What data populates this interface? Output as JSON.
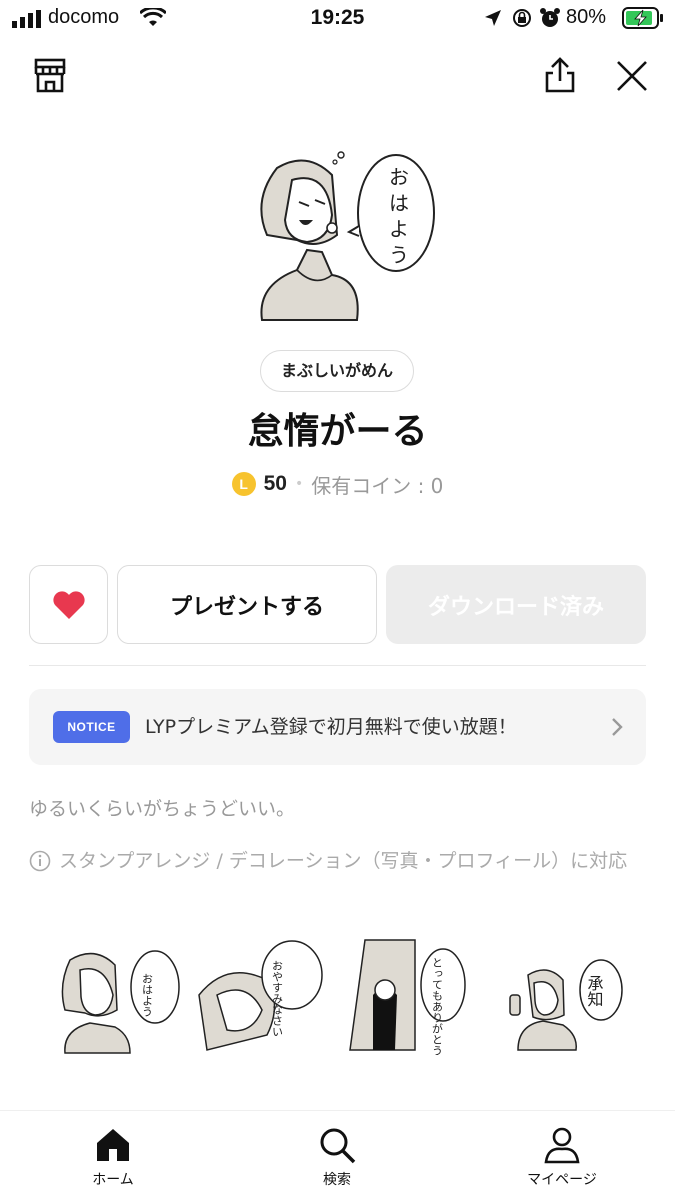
{
  "status_bar": {
    "carrier": "docomo",
    "time": "19:25",
    "battery_percent": "80%"
  },
  "header": {
    "icons": [
      "shop-icon",
      "share-icon",
      "close-icon"
    ]
  },
  "sticker": {
    "creator": "まぶしいがめん",
    "title": "怠惰がーる",
    "coin_symbol": "L",
    "price": "50",
    "owned_coins": "保有コイン : 0"
  },
  "actions": {
    "present_label": "プレゼントする",
    "download_label": "ダウンロード済み"
  },
  "notice": {
    "badge": "NOTICE",
    "text": "LYPプレミアム登録で初月無料で使い放題！"
  },
  "description": "ゆるいくらいがちょうどいい。",
  "info": "スタンプアレンジ / デコレーション（写真・プロフィール）に対応",
  "thumbnails": [
    {
      "bubble": "おはよう"
    },
    {
      "bubble": "おやすみなさい"
    },
    {
      "bubble": "とってもありがとう"
    },
    {
      "bubble": "承知"
    }
  ],
  "tabbar": {
    "home": "ホーム",
    "search": "検索",
    "mypage": "マイページ"
  },
  "colors": {
    "accent_notice": "#4f6ee8",
    "heart": "#e8384f",
    "coin": "#f7c32e"
  }
}
